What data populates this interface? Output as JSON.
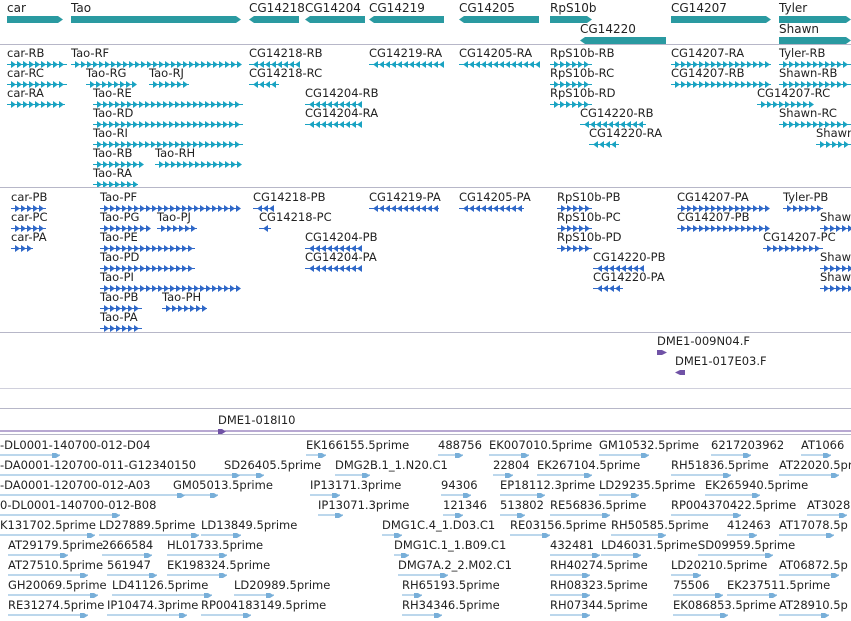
{
  "colors": {
    "gene": "#2a9aa1",
    "transcript": "#1aa3c2",
    "cds": "#2f68c8",
    "clone": "#7052a6",
    "est": "#78afd9",
    "separator": "#b7b7c8",
    "text": "#222222"
  },
  "tracks": {
    "genes": [
      {
        "label": "car"
      },
      {
        "label": "Tao"
      },
      {
        "label": "CG14218"
      },
      {
        "label": "CG14204"
      },
      {
        "label": "CG14219"
      },
      {
        "label": "CG14205"
      },
      {
        "label": "RpS10b"
      },
      {
        "label": "CG14220"
      },
      {
        "label": "CG14207"
      },
      {
        "label": "Tyler"
      },
      {
        "label": "Shawn"
      }
    ],
    "transcripts": [
      {
        "label": "car-RB"
      },
      {
        "label": "car-RC"
      },
      {
        "label": "car-RA"
      },
      {
        "label": "Tao-RF"
      },
      {
        "label": "Tao-RG"
      },
      {
        "label": "Tao-RJ"
      },
      {
        "label": "Tao-RE"
      },
      {
        "label": "Tao-RD"
      },
      {
        "label": "Tao-RI"
      },
      {
        "label": "Tao-RB"
      },
      {
        "label": "Tao-RH"
      },
      {
        "label": "Tao-RA"
      },
      {
        "label": "CG14218-RB"
      },
      {
        "label": "CG14218-RC"
      },
      {
        "label": "CG14204-RB"
      },
      {
        "label": "CG14204-RA"
      },
      {
        "label": "CG14219-RA"
      },
      {
        "label": "CG14205-RA"
      },
      {
        "label": "RpS10b-RB"
      },
      {
        "label": "RpS10b-RC"
      },
      {
        "label": "RpS10b-RD"
      },
      {
        "label": "CG14220-RB"
      },
      {
        "label": "CG14220-RA"
      },
      {
        "label": "CG14207-RA"
      },
      {
        "label": "CG14207-RB"
      },
      {
        "label": "CG14207-RC"
      },
      {
        "label": "Tyler-RB"
      },
      {
        "label": "Shawn-RB"
      },
      {
        "label": "Shawn-RC"
      },
      {
        "label": "Shawn"
      }
    ],
    "cds": [
      {
        "label": "car-PB"
      },
      {
        "label": "car-PC"
      },
      {
        "label": "car-PA"
      },
      {
        "label": "Tao-PF"
      },
      {
        "label": "Tao-PG"
      },
      {
        "label": "Tao-PJ"
      },
      {
        "label": "Tao-PE"
      },
      {
        "label": "Tao-PD"
      },
      {
        "label": "Tao-PI"
      },
      {
        "label": "Tao-PB"
      },
      {
        "label": "Tao-PH"
      },
      {
        "label": "Tao-PA"
      },
      {
        "label": "CG14218-PB"
      },
      {
        "label": "CG14218-PC"
      },
      {
        "label": "CG14204-PB"
      },
      {
        "label": "CG14204-PA"
      },
      {
        "label": "CG14219-PA"
      },
      {
        "label": "CG14205-PA"
      },
      {
        "label": "RpS10b-PB"
      },
      {
        "label": "RpS10b-PC"
      },
      {
        "label": "RpS10b-PD"
      },
      {
        "label": "CG14220-PB"
      },
      {
        "label": "CG14220-PA"
      },
      {
        "label": "CG14207-PA"
      },
      {
        "label": "CG14207-PB"
      },
      {
        "label": "CG14207-PC"
      },
      {
        "label": "Tyler-PB"
      },
      {
        "label": "Shaw"
      },
      {
        "label": "Shaw"
      },
      {
        "label": "Shaw"
      }
    ],
    "clones": [
      {
        "label": "DME1-009N04.F"
      },
      {
        "label": "DME1-017E03.F"
      },
      {
        "label": "DME1-018I10"
      }
    ],
    "ests": [
      {
        "label": "-DL0001-140700-012-D04"
      },
      {
        "label": "EK166155.5prime"
      },
      {
        "label": "488756"
      },
      {
        "label": "EK007010.5prime"
      },
      {
        "label": "GM10532.5prime"
      },
      {
        "label": "6217203962"
      },
      {
        "label": "AT1066"
      },
      {
        "label": "-DA0001-120700-011-G12340150"
      },
      {
        "label": "SD26405.5prime"
      },
      {
        "label": "DMG2B.1_1.N20.C1"
      },
      {
        "label": "22804"
      },
      {
        "label": "EK267104.5prime"
      },
      {
        "label": "RH51836.5prime"
      },
      {
        "label": "AT22020.5pr"
      },
      {
        "label": "-DA0001-120700-012-A03"
      },
      {
        "label": "GM05013.5prime"
      },
      {
        "label": "IP13171.3prime"
      },
      {
        "label": "94306"
      },
      {
        "label": "EP18112.3prime"
      },
      {
        "label": "LD29235.5prime"
      },
      {
        "label": "EK265940.5prime"
      },
      {
        "label": "0-DL0001-140700-012-B08"
      },
      {
        "label": "IP13071.3prime"
      },
      {
        "label": "121346"
      },
      {
        "label": "513802"
      },
      {
        "label": "RE56836.5prime"
      },
      {
        "label": "RP004370422.5prime"
      },
      {
        "label": "AT3028"
      },
      {
        "label": "K131702.5prime"
      },
      {
        "label": "LD27889.5prime"
      },
      {
        "label": "LD13849.5prime"
      },
      {
        "label": "DMG1C.4_1.D03.C1"
      },
      {
        "label": "RE03156.5prime"
      },
      {
        "label": "RH50585.5prime"
      },
      {
        "label": "412463"
      },
      {
        "label": "AT17078.5p"
      },
      {
        "label": "AT29179.5prime"
      },
      {
        "label": "2666584"
      },
      {
        "label": "HL01733.5prime"
      },
      {
        "label": "DMG1C.1_1.B09.C1"
      },
      {
        "label": "432481"
      },
      {
        "label": "LD46031.5prime"
      },
      {
        "label": "SD09959.5prime"
      },
      {
        "label": "AT27510.5prime"
      },
      {
        "label": "561947"
      },
      {
        "label": "EK198324.5prime"
      },
      {
        "label": "DMG7A.2_2.M02.C1"
      },
      {
        "label": "RH40274.5prime"
      },
      {
        "label": "LD20210.5prime"
      },
      {
        "label": "AT06872.5p"
      },
      {
        "label": "GH20069.5prime"
      },
      {
        "label": "LD41126.5prime"
      },
      {
        "label": "LD20989.5prime"
      },
      {
        "label": "RH65193.5prime"
      },
      {
        "label": "RH08323.5prime"
      },
      {
        "label": "75506"
      },
      {
        "label": "EK237511.5prime"
      },
      {
        "label": "RE31274.5prime"
      },
      {
        "label": "IP10474.3prime"
      },
      {
        "label": "RP004183149.5prime"
      },
      {
        "label": "RH34346.5prime"
      },
      {
        "label": "RH07344.5prime"
      },
      {
        "label": "EK086853.5prime"
      },
      {
        "label": "AT28910.5p"
      }
    ]
  }
}
